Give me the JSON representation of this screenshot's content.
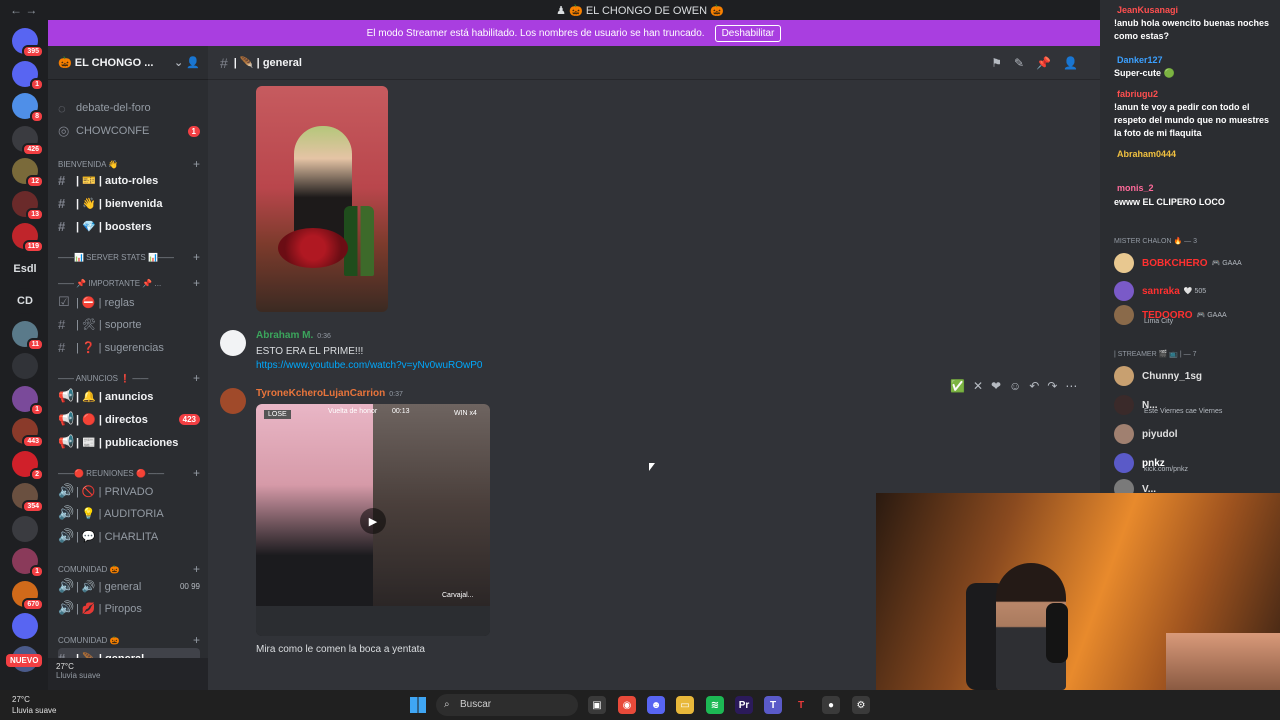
{
  "window": {
    "title": "♟ 🎃 EL CHONGO DE OWEN 🎃",
    "nav": "←  →"
  },
  "banner": {
    "text": "El modo Streamer está habilitado. Los nombres de usuario se han truncado.",
    "button": "Deshabilitar"
  },
  "rail": {
    "items": [
      {
        "label": "",
        "badge": "395",
        "color": "#5865f2"
      },
      {
        "label": "",
        "badge": "1",
        "color": "#5865f2"
      },
      {
        "label": "",
        "badge": "8",
        "color": "#4f8fe8"
      },
      {
        "label": "",
        "badge": "426",
        "color": "#3a3b40"
      },
      {
        "label": "",
        "badge": "12",
        "color": "#7a6a3a"
      },
      {
        "label": "",
        "badge": "13",
        "color": "#6a2a2a"
      },
      {
        "label": "",
        "badge": "119",
        "color": "#c0252b"
      },
      {
        "label": "Esdl",
        "badge": "",
        "color": "#1e1f22"
      },
      {
        "label": "CD",
        "badge": "",
        "color": "#1e1f22"
      },
      {
        "label": "",
        "badge": "11",
        "color": "#5a7a8a"
      },
      {
        "label": "",
        "badge": "",
        "color": "#313338"
      },
      {
        "label": "",
        "badge": "1",
        "color": "#7a4a9a"
      },
      {
        "label": "",
        "badge": "443",
        "color": "#8a3a2a"
      },
      {
        "label": "",
        "badge": "2",
        "color": "#d0202a"
      },
      {
        "label": "",
        "badge": "354",
        "color": "#6a5040"
      },
      {
        "label": "",
        "badge": "",
        "color": "#3a3b40"
      },
      {
        "label": "",
        "badge": "1",
        "color": "#8a3a5a"
      },
      {
        "label": "",
        "badge": "670",
        "color": "#d06a1a"
      },
      {
        "label": "",
        "badge": "",
        "color": "#5865f2"
      },
      {
        "label": "",
        "badge": "",
        "color": "#4a5a8a"
      }
    ],
    "nuevo": "NUEVO"
  },
  "sidebar": {
    "server_name": "🎃 EL CHONGO ...",
    "channels": [
      {
        "kind": "ch",
        "icon": "◌",
        "label": "debate-del-foro",
        "count": "",
        "style": ""
      },
      {
        "kind": "ch",
        "icon": "◎",
        "label": "CHOWCONFE",
        "count": "1",
        "style": ""
      },
      {
        "kind": "cat",
        "label": "BIENVENIDA 👋"
      },
      {
        "kind": "ch",
        "icon": "#",
        "label": "| 🎫 | auto-roles",
        "count": "",
        "style": "bold"
      },
      {
        "kind": "ch",
        "icon": "#",
        "label": "| 👋 | bienvenida",
        "count": "",
        "style": "bold"
      },
      {
        "kind": "ch",
        "icon": "#",
        "label": "| 💎 | boosters",
        "count": "",
        "style": "bold"
      },
      {
        "kind": "cat",
        "label": "——📊 SERVER STATS 📊——"
      },
      {
        "kind": "cat",
        "label": "—— 📌 Importante 📌 ..."
      },
      {
        "kind": "ch",
        "icon": "☑",
        "label": "| ⛔ | reglas",
        "count": "",
        "style": ""
      },
      {
        "kind": "ch",
        "icon": "#",
        "label": "| 🛠 | soporte",
        "count": "",
        "style": ""
      },
      {
        "kind": "ch",
        "icon": "#",
        "label": "| ❓ | sugerencias",
        "count": "",
        "style": ""
      },
      {
        "kind": "cat",
        "label": "—— ANUNCIOS ❗ ——"
      },
      {
        "kind": "ch",
        "icon": "📢",
        "label": "| 🔔 | anuncios",
        "count": "",
        "style": "bold"
      },
      {
        "kind": "ch",
        "icon": "📢",
        "label": "| 🔴 | directos",
        "count": "423",
        "style": "bold"
      },
      {
        "kind": "ch",
        "icon": "📢",
        "label": "| 📰 | publicaciones",
        "count": "",
        "style": "bold"
      },
      {
        "kind": "cat",
        "label": "——🔴 REUNIONES 🔴 ——"
      },
      {
        "kind": "ch",
        "icon": "🔊",
        "label": "| 🚫 | PRIVADO",
        "count": "",
        "style": ""
      },
      {
        "kind": "ch",
        "icon": "🔊",
        "label": "| 💡 | AUDITORIA",
        "count": "",
        "style": ""
      },
      {
        "kind": "ch",
        "icon": "🔊",
        "label": "| 💬 | CHARLITA",
        "count": "",
        "style": ""
      },
      {
        "kind": "cat",
        "label": "COMUNIDAD 🎃"
      },
      {
        "kind": "ch",
        "icon": "🔊",
        "label": "| 🔊 | general",
        "count": "",
        "style": "",
        "tag": "00 99"
      },
      {
        "kind": "ch",
        "icon": "🔊",
        "label": "| 💋 | Piropos",
        "count": "",
        "style": ""
      },
      {
        "kind": "cat",
        "label": "COMUNIDAD 🎃"
      },
      {
        "kind": "ch",
        "icon": "#",
        "label": "| 🪶 | general",
        "count": "",
        "style": "sel"
      }
    ],
    "weather_temp": "27°C",
    "weather_desc": "Lluvia suave"
  },
  "chat": {
    "channel": "| 🪶 | general",
    "messages": [
      {
        "author": "Abraham M.",
        "author_color": "#3ba55c",
        "time": "0:36",
        "text": "ESTO ERA EL PRIME!!!",
        "link": "https://www.youtube.com/watch?v=yNv0wuROwP0"
      },
      {
        "author": "TyroneKcheroLujanCarrion",
        "author_color": "#e8743b",
        "time": "0:37",
        "video_top": "Vuelta de honor",
        "video_timer": "00:13",
        "video_lose": "LOSE",
        "video_win": "WIN x4",
        "video_name": "Carvajal...",
        "text": "Mira como le comen la boca a yentata"
      }
    ]
  },
  "twitch": [
    {
      "name": "JeanKusanagi",
      "name_color": "#ff4f4f",
      "text": "!anub hola owencito buenas noches como estas?"
    },
    {
      "name": "Danker127",
      "name_color": "#3ba0ff",
      "text": "Super-cute 🟢"
    },
    {
      "name": "fabriugu2",
      "name_color": "#ff4f4f",
      "text": "!anun te voy a pedir con todo el respeto del mundo que no muestres la foto de mi flaquita"
    },
    {
      "name": "Abraham0444",
      "name_color": "#f0c040",
      "text": ""
    },
    {
      "name": "monis_2",
      "name_color": "#ff6a9a",
      "text": ""
    },
    {
      "name": "",
      "name_color": "#ffffff",
      "text": "ewww  EL CLIPERO LOCO"
    }
  ],
  "members": {
    "cat1": "MISTER CHALON 🔥 — 3",
    "group1": [
      {
        "name": "BOBKCHERO",
        "color": "#ff3030",
        "tag": "🎮 GAAA"
      },
      {
        "name": "sanraka",
        "color": "#ff3030",
        "tag": "🤍 505"
      },
      {
        "name": "TEDOORO",
        "color": "#ff3030",
        "tag": "🎮 GAAA",
        "sub": "Lima City"
      }
    ],
    "cat2": "| Streamer 🎬 📺 | — 7",
    "group2": [
      {
        "name": "Chunny_1sg",
        "color": "#e0e0e0",
        "tag": ""
      },
      {
        "name": "N...",
        "color": "#e0e0e0",
        "tag": "",
        "sub": "Este Viernes cae Viernes"
      },
      {
        "name": "piyudol",
        "color": "#e0e0e0",
        "tag": ""
      },
      {
        "name": "pnkz",
        "color": "#ffffff",
        "tag": "",
        "sub": "kick.com/pnkz"
      },
      {
        "name": "V...",
        "color": "#e0e0e0",
        "tag": ""
      }
    ]
  },
  "taskbar": {
    "search_placeholder": "Buscar"
  }
}
